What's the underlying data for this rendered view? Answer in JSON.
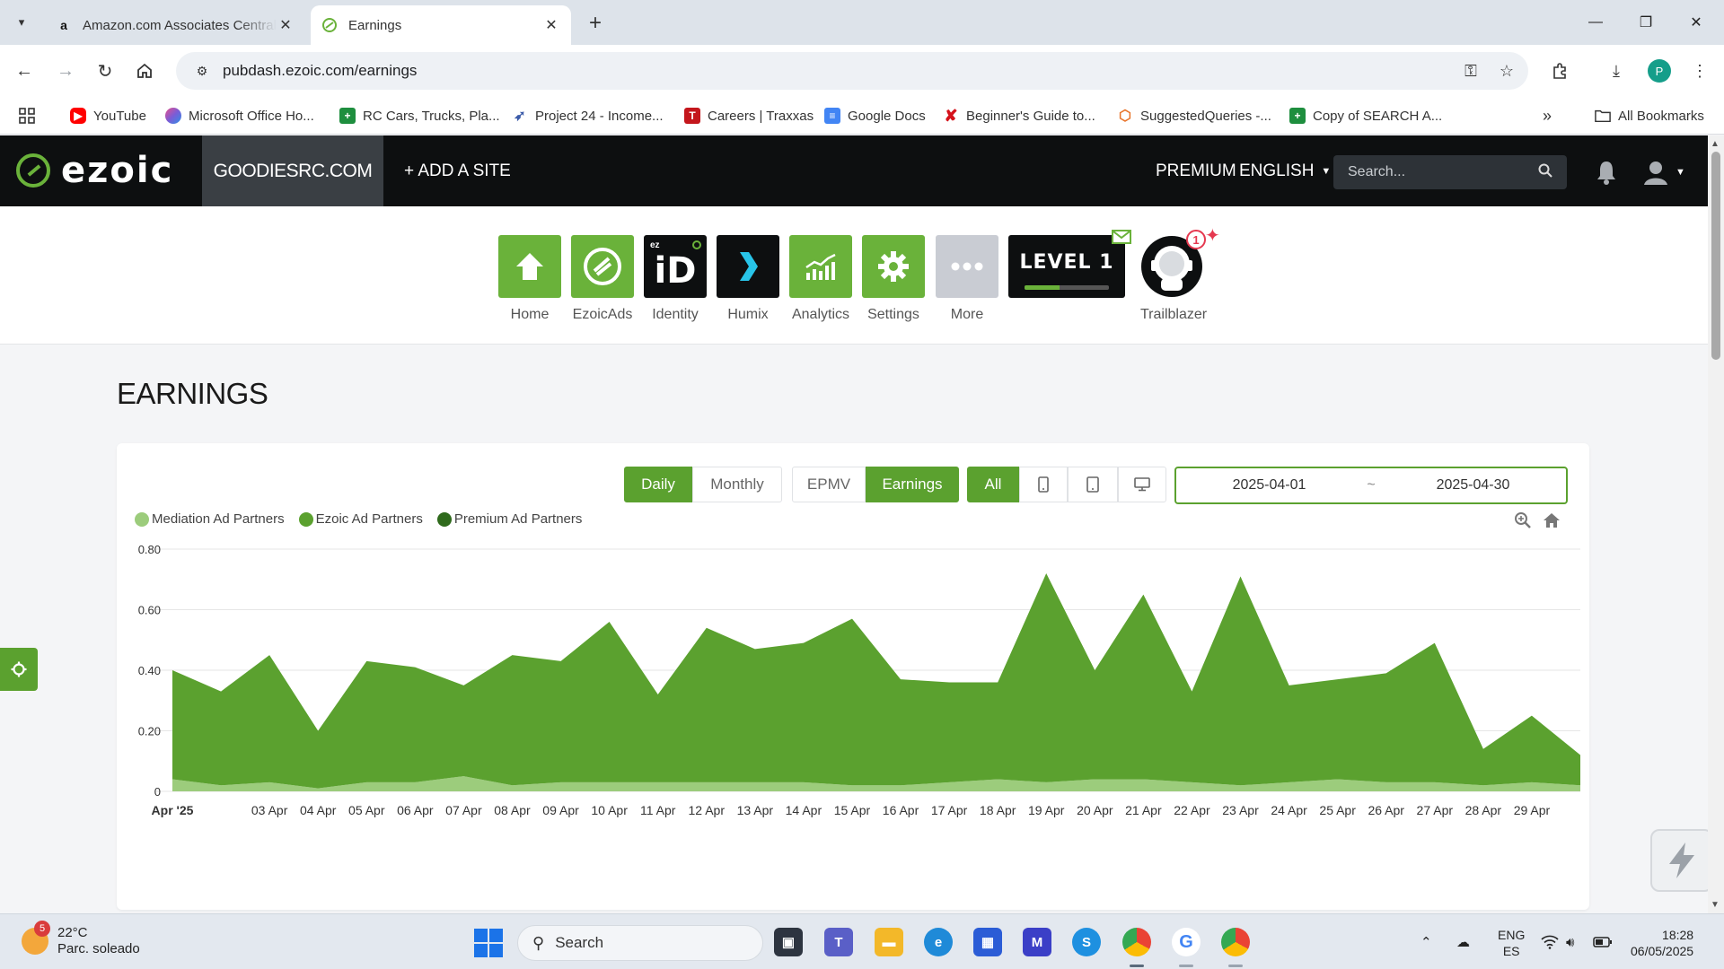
{
  "browser": {
    "tabs": [
      {
        "title": "Amazon.com Associates Central",
        "favicon": "amazon-icon",
        "active": false
      },
      {
        "title": "Earnings",
        "favicon": "ezoic-icon",
        "active": true
      }
    ],
    "url": "pubdash.ezoic.com/earnings",
    "profile_initial": "P",
    "bookmarks": [
      {
        "label": "YouTube",
        "icon": "youtube-icon",
        "color": "#ff0000"
      },
      {
        "label": "Microsoft Office Ho...",
        "icon": "office-icon",
        "color": "#7b5cd6"
      },
      {
        "label": "RC Cars, Trucks, Pla...",
        "icon": "sheets-icon",
        "color": "#1e8e3e"
      },
      {
        "label": "Project 24 - Income...",
        "icon": "rocket-icon",
        "color": "#3b5ba9"
      },
      {
        "label": "Careers | Traxxas",
        "icon": "traxxas-icon",
        "color": "#c4161c"
      },
      {
        "label": "Google Docs",
        "icon": "docs-icon",
        "color": "#4285f4"
      },
      {
        "label": "Beginner's Guide to...",
        "icon": "x-logo-icon",
        "color": "#d5121b"
      },
      {
        "label": "SuggestedQueries -...",
        "icon": "suggestedqueries-icon",
        "color": "#e8742a"
      },
      {
        "label": "Copy of SEARCH A...",
        "icon": "sheets-icon",
        "color": "#1e8e3e"
      }
    ],
    "all_bookmarks": "All Bookmarks"
  },
  "header": {
    "logo": "ezoic",
    "site": "GOODIESRC.COM",
    "add_site": "+ ADD A SITE",
    "premium": "PREMIUM",
    "language": "ENGLISH",
    "search_placeholder": "Search..."
  },
  "apps": [
    {
      "label": "Home",
      "icon": "home-icon"
    },
    {
      "label": "EzoicAds",
      "icon": "ezoic-ads-icon"
    },
    {
      "label": "Identity",
      "icon": "identity-icon"
    },
    {
      "label": "Humix",
      "icon": "humix-icon"
    },
    {
      "label": "Analytics",
      "icon": "analytics-icon"
    },
    {
      "label": "Settings",
      "icon": "settings-icon"
    },
    {
      "label": "More",
      "icon": "more-icon"
    }
  ],
  "level": {
    "text": "LEVEL 1",
    "progress": 0.42
  },
  "trailblazer": {
    "label": "Trailblazer",
    "badge": "1"
  },
  "page": {
    "title": "EARNINGS"
  },
  "controls": {
    "period": [
      "Daily",
      "Monthly"
    ],
    "period_selected": "Daily",
    "metric": [
      "EPMV",
      "Earnings"
    ],
    "metric_selected": "Earnings",
    "device_all": "All",
    "date_from": "2025-04-01",
    "date_to": "2025-04-30",
    "date_separator": "~"
  },
  "colors": {
    "brand_green": "#5ba12f",
    "mediation": "#9ccc7c",
    "ezoic": "#5ba12f",
    "premium": "#2f6a1c"
  },
  "chart_data": {
    "type": "area",
    "stacked": true,
    "y_ticks": [
      "0",
      "0.20",
      "0.40",
      "0.60",
      "0.80"
    ],
    "ylim": [
      0,
      0.8
    ],
    "x_labels": [
      "Apr '25",
      "03 Apr",
      "04 Apr",
      "05 Apr",
      "06 Apr",
      "07 Apr",
      "08 Apr",
      "09 Apr",
      "10 Apr",
      "11 Apr",
      "12 Apr",
      "13 Apr",
      "14 Apr",
      "15 Apr",
      "16 Apr",
      "17 Apr",
      "18 Apr",
      "19 Apr",
      "20 Apr",
      "21 Apr",
      "22 Apr",
      "23 Apr",
      "24 Apr",
      "25 Apr",
      "26 Apr",
      "27 Apr",
      "28 Apr",
      "29 Apr"
    ],
    "x": [
      "2025-04-01",
      "2025-04-02",
      "2025-04-03",
      "2025-04-04",
      "2025-04-05",
      "2025-04-06",
      "2025-04-07",
      "2025-04-08",
      "2025-04-09",
      "2025-04-10",
      "2025-04-11",
      "2025-04-12",
      "2025-04-13",
      "2025-04-14",
      "2025-04-15",
      "2025-04-16",
      "2025-04-17",
      "2025-04-18",
      "2025-04-19",
      "2025-04-20",
      "2025-04-21",
      "2025-04-22",
      "2025-04-23",
      "2025-04-24",
      "2025-04-25",
      "2025-04-26",
      "2025-04-27",
      "2025-04-28",
      "2025-04-29",
      "2025-04-30"
    ],
    "series": [
      {
        "name": "Mediation Ad Partners",
        "color": "#9ccc7c",
        "values": [
          0.04,
          0.02,
          0.03,
          0.01,
          0.03,
          0.03,
          0.05,
          0.02,
          0.03,
          0.03,
          0.03,
          0.03,
          0.03,
          0.03,
          0.02,
          0.02,
          0.03,
          0.04,
          0.03,
          0.04,
          0.04,
          0.03,
          0.02,
          0.03,
          0.04,
          0.03,
          0.03,
          0.02,
          0.03,
          0.02
        ]
      },
      {
        "name": "Ezoic Ad Partners",
        "color": "#5ba12f",
        "values": [
          0.36,
          0.31,
          0.42,
          0.19,
          0.4,
          0.38,
          0.3,
          0.43,
          0.4,
          0.53,
          0.29,
          0.51,
          0.44,
          0.46,
          0.55,
          0.35,
          0.33,
          0.32,
          0.69,
          0.36,
          0.61,
          0.3,
          0.69,
          0.32,
          0.33,
          0.36,
          0.46,
          0.12,
          0.22,
          0.1
        ]
      },
      {
        "name": "Premium Ad Partners",
        "color": "#2f6a1c",
        "values": [
          0,
          0,
          0,
          0,
          0,
          0,
          0,
          0,
          0,
          0,
          0,
          0,
          0,
          0,
          0,
          0,
          0,
          0,
          0,
          0,
          0,
          0,
          0,
          0,
          0,
          0,
          0,
          0,
          0,
          0
        ]
      }
    ]
  },
  "taskbar": {
    "weather_temp": "22°C",
    "weather_desc": "Parc. soleado",
    "weather_badge": "5",
    "search": "Search",
    "lang_top": "ENG",
    "lang_bottom": "ES",
    "time": "18:28",
    "date": "06/05/2025"
  }
}
